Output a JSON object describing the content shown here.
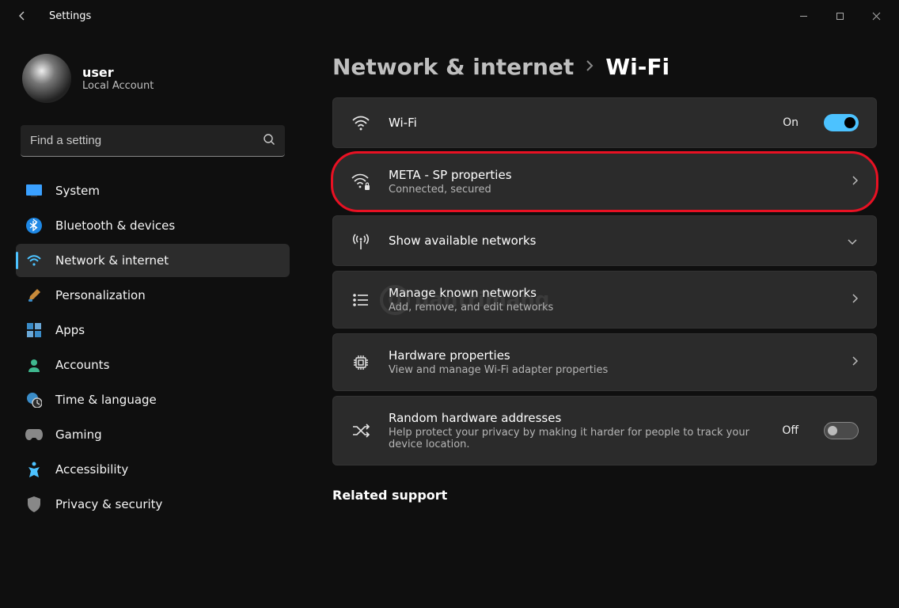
{
  "titlebar": {
    "title": "Settings"
  },
  "profile": {
    "name": "user",
    "sub": "Local Account"
  },
  "search": {
    "placeholder": "Find a setting"
  },
  "nav": {
    "items": [
      {
        "label": "System"
      },
      {
        "label": "Bluetooth & devices"
      },
      {
        "label": "Network & internet"
      },
      {
        "label": "Personalization"
      },
      {
        "label": "Apps"
      },
      {
        "label": "Accounts"
      },
      {
        "label": "Time & language"
      },
      {
        "label": "Gaming"
      },
      {
        "label": "Accessibility"
      },
      {
        "label": "Privacy & security"
      }
    ],
    "selected_index": 2
  },
  "breadcrumb": {
    "parent": "Network & internet",
    "current": "Wi-Fi"
  },
  "cards": {
    "wifi": {
      "title": "Wi-Fi",
      "state_label": "On"
    },
    "network": {
      "title": "META - SP properties",
      "sub": "Connected, secured"
    },
    "available": {
      "title": "Show available networks"
    },
    "known": {
      "title": "Manage known networks",
      "sub": "Add, remove, and edit networks"
    },
    "hardware": {
      "title": "Hardware properties",
      "sub": "View and manage Wi-Fi adapter properties"
    },
    "random": {
      "title": "Random hardware addresses",
      "sub": "Help protect your privacy by making it harder for people to track your device location.",
      "state_label": "Off"
    }
  },
  "related": {
    "title": "Related support"
  },
  "watermark": {
    "text": "uantrimang"
  }
}
